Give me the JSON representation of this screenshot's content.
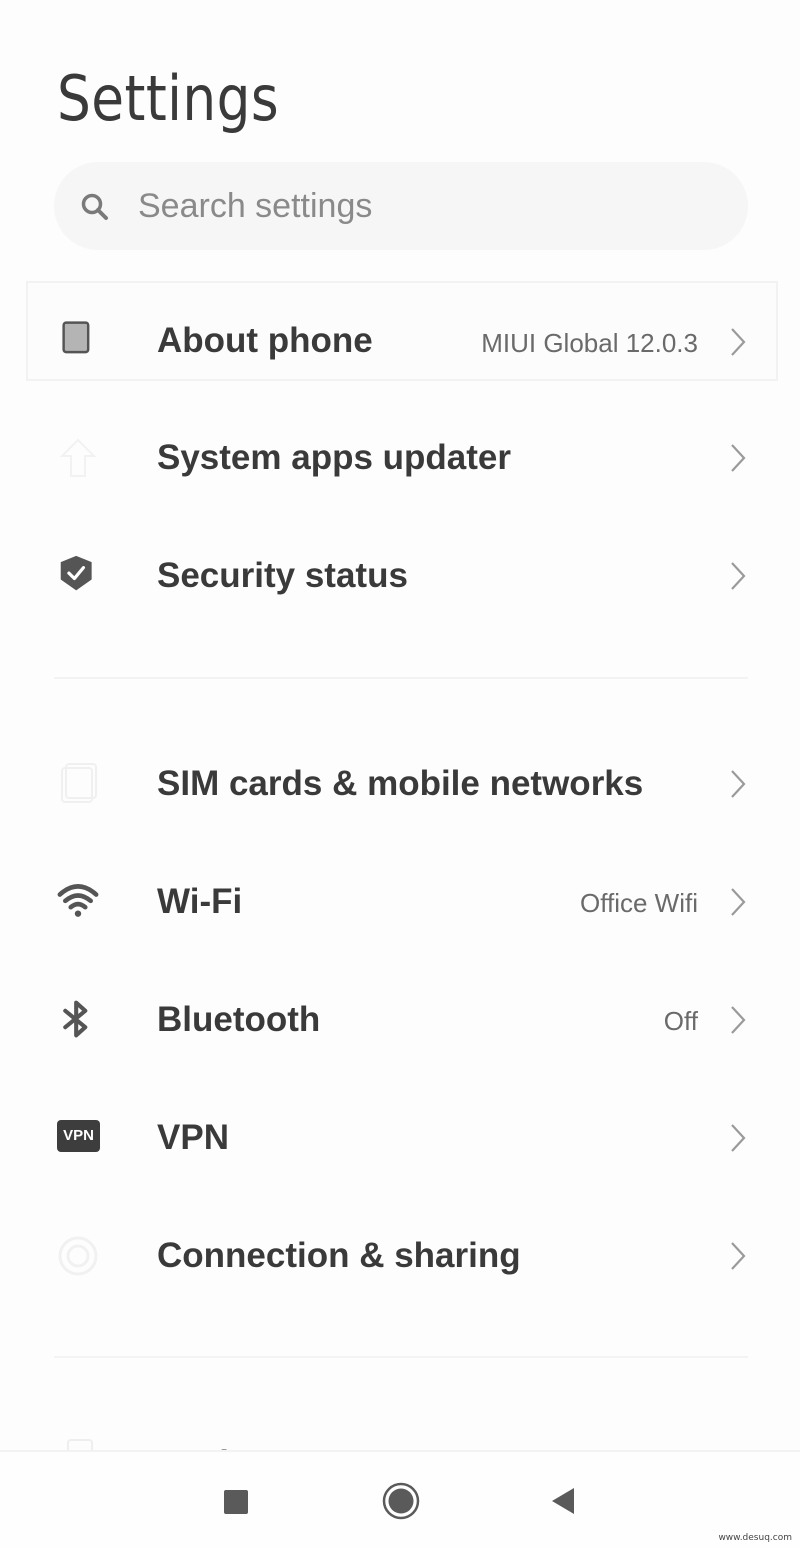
{
  "header": {
    "title": "Settings"
  },
  "search": {
    "placeholder": "Search settings",
    "value": ""
  },
  "sections": [
    {
      "items": [
        {
          "id": "about-phone",
          "label": "About phone",
          "value": "MIUI Global 12.0.3",
          "icon": "phone-icon",
          "highlighted": true
        },
        {
          "id": "system-apps-updater",
          "label": "System apps updater",
          "value": "",
          "icon": "arrow-up-icon"
        },
        {
          "id": "security-status",
          "label": "Security status",
          "value": "",
          "icon": "shield-check-icon"
        }
      ]
    },
    {
      "items": [
        {
          "id": "sim-cards",
          "label": "SIM cards & mobile networks",
          "value": "",
          "icon": "sim-card-icon"
        },
        {
          "id": "wifi",
          "label": "Wi-Fi",
          "value": "Office Wifi",
          "icon": "wifi-icon"
        },
        {
          "id": "bluetooth",
          "label": "Bluetooth",
          "value": "Off",
          "icon": "bluetooth-icon"
        },
        {
          "id": "vpn",
          "label": "VPN",
          "value": "",
          "icon": "vpn-icon",
          "icon_text": "VPN"
        },
        {
          "id": "connection-sharing",
          "label": "Connection & sharing",
          "value": "",
          "icon": "connection-sharing-icon"
        }
      ]
    },
    {
      "items": [
        {
          "id": "lock-screen",
          "label": "Lock screen",
          "value": "",
          "icon": "lock-icon",
          "partially_visible": true
        }
      ]
    }
  ],
  "nav_bar": {
    "buttons": [
      {
        "id": "recents",
        "icon": "square-icon"
      },
      {
        "id": "home",
        "icon": "circle-icon"
      },
      {
        "id": "back",
        "icon": "triangle-back-icon"
      }
    ]
  },
  "watermark": "www.desuq.com",
  "colors": {
    "background": "#fdfdfd",
    "text_primary": "#3a3a3a",
    "text_secondary": "#6a6a6a",
    "icon_dark": "#555555",
    "chevron": "#9a9a9a"
  }
}
